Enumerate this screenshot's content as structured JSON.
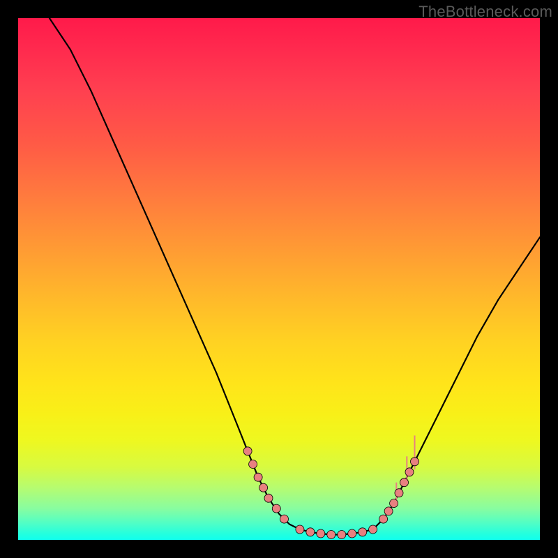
{
  "watermark": "TheBottleneck.com",
  "colors": {
    "top": "#ff1a4a",
    "bottom": "#10ffee",
    "curve": "#000000",
    "marker": "#e88080",
    "frame": "#000000"
  },
  "chart_data": {
    "type": "line",
    "title": "",
    "xlabel": "",
    "ylabel": "",
    "xlim": [
      0,
      100
    ],
    "ylim": [
      0,
      100
    ],
    "curve_left": {
      "x": [
        6,
        10,
        14,
        18,
        22,
        26,
        30,
        34,
        38,
        42,
        44,
        46,
        48,
        50,
        52
      ],
      "y": [
        100,
        94,
        86,
        77,
        68,
        59,
        50,
        41,
        32,
        22,
        17,
        12,
        8,
        5,
        3
      ]
    },
    "curve_flat": {
      "x": [
        52,
        54,
        56,
        58,
        60,
        62,
        64,
        66,
        68
      ],
      "y": [
        3,
        2,
        1.5,
        1.2,
        1.0,
        1.0,
        1.2,
        1.5,
        2
      ]
    },
    "curve_right": {
      "x": [
        68,
        70,
        72,
        74,
        76,
        80,
        84,
        88,
        92,
        96,
        100
      ],
      "y": [
        2,
        4,
        7,
        11,
        15,
        23,
        31,
        39,
        46,
        52,
        58
      ]
    },
    "markers_left_descent": [
      {
        "x": 44.0,
        "y": 17.0
      },
      {
        "x": 45.0,
        "y": 14.5
      },
      {
        "x": 46.0,
        "y": 12.0
      },
      {
        "x": 47.0,
        "y": 10.0
      },
      {
        "x": 48.0,
        "y": 8.0
      },
      {
        "x": 49.5,
        "y": 6.0
      },
      {
        "x": 51.0,
        "y": 4.0
      }
    ],
    "markers_valley": [
      {
        "x": 54.0,
        "y": 2.0
      },
      {
        "x": 56.0,
        "y": 1.5
      },
      {
        "x": 58.0,
        "y": 1.2
      },
      {
        "x": 60.0,
        "y": 1.0
      },
      {
        "x": 62.0,
        "y": 1.0
      },
      {
        "x": 64.0,
        "y": 1.2
      },
      {
        "x": 66.0,
        "y": 1.5
      },
      {
        "x": 68.0,
        "y": 2.0
      }
    ],
    "markers_right_ascent": [
      {
        "x": 70.0,
        "y": 4.0
      },
      {
        "x": 71.0,
        "y": 5.5
      },
      {
        "x": 72.0,
        "y": 7.0
      },
      {
        "x": 73.0,
        "y": 9.0
      },
      {
        "x": 74.0,
        "y": 11.0
      },
      {
        "x": 75.0,
        "y": 13.0
      },
      {
        "x": 76.0,
        "y": 15.0
      }
    ],
    "spikes_right": [
      {
        "x": 72.5,
        "y": 8.0,
        "h": 3
      },
      {
        "x": 74.5,
        "y": 12.0,
        "h": 4
      },
      {
        "x": 76.0,
        "y": 15.0,
        "h": 5
      }
    ]
  }
}
